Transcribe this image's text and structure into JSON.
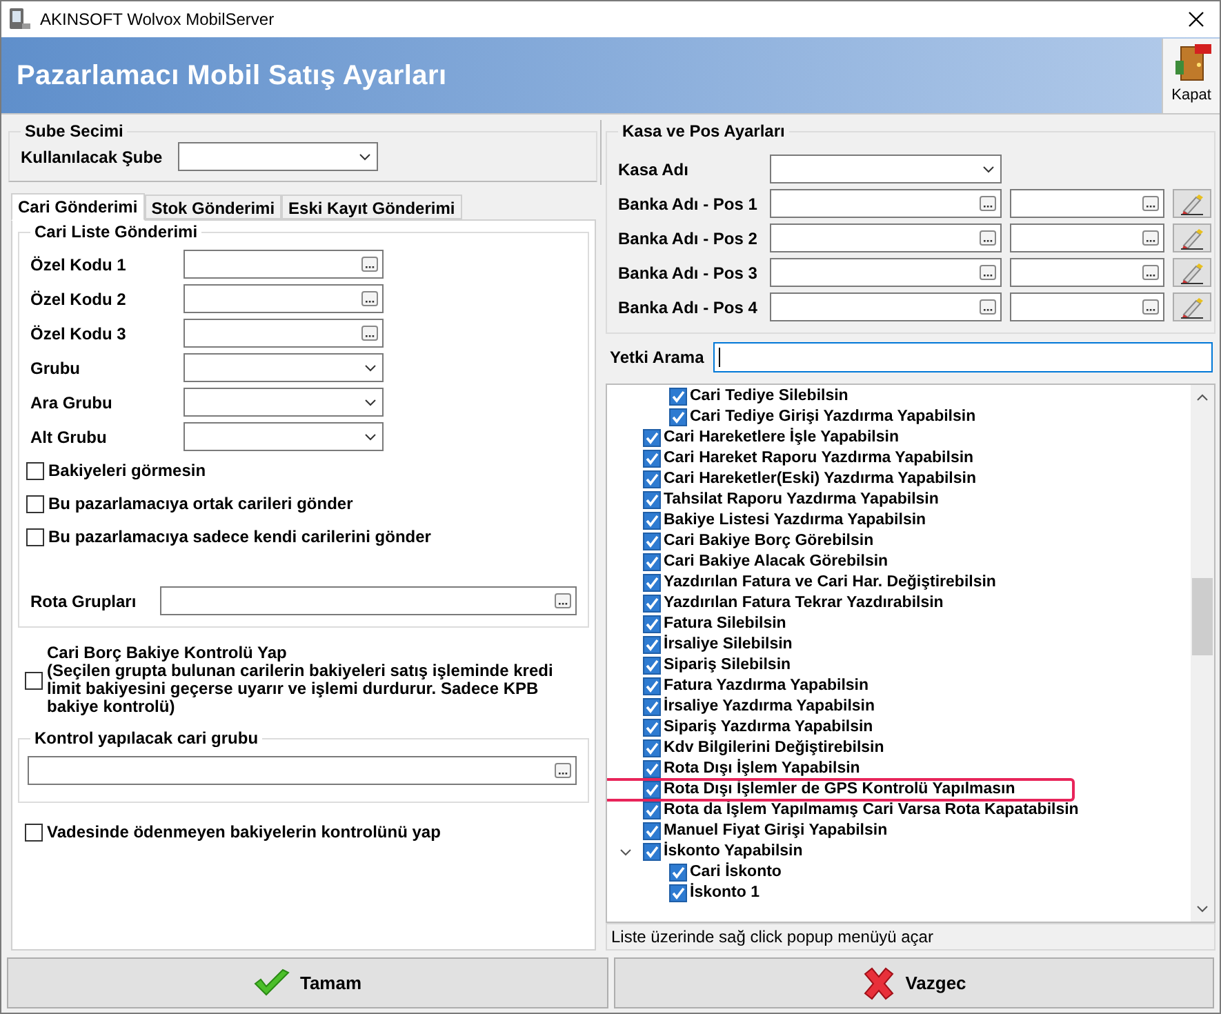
{
  "window": {
    "title": "AKINSOFT Wolvox MobilServer"
  },
  "header": {
    "title": "Pazarlamacı Mobil Satış Ayarları",
    "close_button": "Kapat"
  },
  "branch": {
    "legend": "Sube Secimi",
    "label": "Kullanılacak Şube"
  },
  "tabs": [
    {
      "label": "Cari Gönderimi",
      "selected": true
    },
    {
      "label": "Stok Gönderimi",
      "selected": false
    },
    {
      "label": "Eski Kayıt Gönderimi",
      "selected": false
    }
  ],
  "cari_liste": {
    "legend": "Cari Liste Gönderimi",
    "fields": [
      {
        "label": "Özel Kodu 1",
        "kind": "lookup"
      },
      {
        "label": "Özel Kodu 2",
        "kind": "lookup"
      },
      {
        "label": "Özel Kodu 3",
        "kind": "lookup"
      },
      {
        "label": "Grubu",
        "kind": "dropdown"
      },
      {
        "label": "Ara Grubu",
        "kind": "dropdown"
      },
      {
        "label": "Alt Grubu",
        "kind": "dropdown"
      }
    ],
    "checkboxes": [
      {
        "label": "Bakiyeleri görmesin",
        "checked": false
      },
      {
        "label": "Bu pazarlamacıya ortak carileri gönder",
        "checked": false
      },
      {
        "label": "Bu pazarlamacıya sadece kendi carilerini gönder",
        "checked": false
      }
    ],
    "route_groups": {
      "label": "Rota Grupları"
    }
  },
  "credit_check": {
    "title": "Cari Borç Bakiye Kontrolü Yap",
    "description": "(Seçilen grupta bulunan carilerin bakiyeleri satış işleminde kredi limit bakiyesini geçerse uyarır ve işlemi durdurur. Sadece KPB bakiye kontrolü)",
    "checked": false
  },
  "control_group": {
    "legend": "Kontrol yapılacak cari grubu"
  },
  "overdue_check": {
    "label": "Vadesinde ödenmeyen bakiyelerin kontrolünü yap",
    "checked": false
  },
  "kasa": {
    "legend": "Kasa ve Pos Ayarları",
    "kasa_label": "Kasa Adı",
    "pos_rows": [
      {
        "label": "Banka Adı - Pos 1"
      },
      {
        "label": "Banka Adı - Pos 2"
      },
      {
        "label": "Banka Adı - Pos 3"
      },
      {
        "label": "Banka Adı - Pos 4"
      }
    ]
  },
  "search": {
    "label": "Yetki Arama"
  },
  "tree": {
    "items": [
      {
        "children": [
          {
            "label": "Cari Tediye Silebilsin",
            "checked": true,
            "highlighted": false
          },
          {
            "label": "Cari Tediye Girişi Yazdırma Yapabilsin",
            "checked": true,
            "highlighted": false
          }
        ]
      },
      {
        "label": "Cari Hareketlere İşle Yapabilsin",
        "checked": true,
        "highlighted": false
      },
      {
        "label": "Cari Hareket Raporu Yazdırma Yapabilsin",
        "checked": true,
        "highlighted": false
      },
      {
        "label": "Cari Hareketler(Eski) Yazdırma Yapabilsin",
        "checked": true,
        "highlighted": false
      },
      {
        "label": "Tahsilat Raporu Yazdırma Yapabilsin",
        "checked": true,
        "highlighted": false
      },
      {
        "label": "Bakiye Listesi Yazdırma Yapabilsin",
        "checked": true,
        "highlighted": false
      },
      {
        "label": "Cari Bakiye Borç Görebilsin",
        "checked": true,
        "highlighted": false
      },
      {
        "label": "Cari Bakiye Alacak Görebilsin",
        "checked": true,
        "highlighted": false
      },
      {
        "label": "Yazdırılan Fatura ve Cari Har. Değiştirebilsin",
        "checked": true,
        "highlighted": false
      },
      {
        "label": "Yazdırılan Fatura Tekrar Yazdırabilsin",
        "checked": true,
        "highlighted": false
      },
      {
        "label": "Fatura Silebilsin",
        "checked": true,
        "highlighted": false
      },
      {
        "label": "İrsaliye Silebilsin",
        "checked": true,
        "highlighted": false
      },
      {
        "label": "Sipariş Silebilsin",
        "checked": true,
        "highlighted": false
      },
      {
        "label": "Fatura Yazdırma Yapabilsin",
        "checked": true,
        "highlighted": false
      },
      {
        "label": "İrsaliye Yazdırma Yapabilsin",
        "checked": true,
        "highlighted": false
      },
      {
        "label": "Sipariş Yazdırma Yapabilsin",
        "checked": true,
        "highlighted": false
      },
      {
        "label": "Kdv Bilgilerini Değiştirebilsin",
        "checked": true,
        "highlighted": false
      },
      {
        "label": "Rota Dışı İşlem Yapabilsin",
        "checked": true,
        "highlighted": false
      },
      {
        "label": "Rota Dışı İşlemler de GPS Kontrolü Yapılmasın",
        "checked": true,
        "highlighted": true
      },
      {
        "label": "Rota da İşlem Yapılmamış Cari Varsa Rota Kapatabilsin",
        "checked": true,
        "highlighted": false
      },
      {
        "label": "Manuel Fiyat Girişi Yapabilsin",
        "checked": true,
        "highlighted": false
      },
      {
        "label": "İskonto Yapabilsin",
        "checked": true,
        "highlighted": false,
        "expanded": true,
        "children": [
          {
            "label": "Cari İskonto",
            "checked": true,
            "highlighted": false
          },
          {
            "label": "İskonto 1",
            "checked": true,
            "highlighted": false
          }
        ]
      }
    ]
  },
  "status_text": "Liste üzerinde sağ click popup menüyü açar",
  "buttons": [
    {
      "label": "Tamam",
      "kind": "ok"
    },
    {
      "label": "Vazgec",
      "kind": "cancel"
    }
  ]
}
